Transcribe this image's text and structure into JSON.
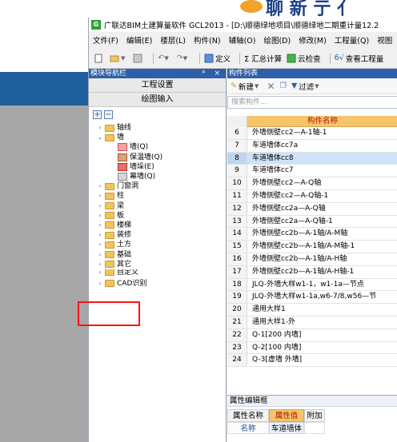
{
  "background": {
    "logo_text": "聊 新 亍 亻"
  },
  "window": {
    "title": "广联达BIM土建算量软件 GCL2013 - [D:\\顺德绿地项目\\顺德绿地二期重计量12.2"
  },
  "menu": [
    "文件(F)",
    "编辑(E)",
    "楼层(L)",
    "构件(N)",
    "辅轴(O)",
    "绘图(D)",
    "修改(M)",
    "工程量(Q)",
    "视图"
  ],
  "toolbar": {
    "define_label": "定义",
    "sum_label": "Σ 汇总计算",
    "cloud_check_label": "云检查",
    "view_quantity_label": "查看工程量"
  },
  "nav_panel": {
    "title": "模块导航栏",
    "header_controls": "ᵖ ×",
    "tabs": [
      "工程设置",
      "绘图输入"
    ],
    "expand_label": "+",
    "collapse_label": "−",
    "tree": [
      {
        "label": "轴线",
        "expanded": false,
        "level": 0
      },
      {
        "label": "墙",
        "expanded": true,
        "level": 0
      },
      {
        "label": "墙(Q)",
        "level": 1,
        "icon": "wall"
      },
      {
        "label": "保温墙(Q)",
        "level": 1,
        "icon": "insulation-wall"
      },
      {
        "label": "墙垛(E)",
        "level": 1,
        "icon": "wall-pier"
      },
      {
        "label": "幕墙(Q)",
        "level": 1,
        "icon": "curtain-wall"
      },
      {
        "label": "门窗洞",
        "expanded": false,
        "level": 0
      },
      {
        "label": "柱",
        "expanded": false,
        "level": 0
      },
      {
        "label": "梁",
        "expanded": false,
        "level": 0
      },
      {
        "label": "板",
        "expanded": false,
        "level": 0
      },
      {
        "label": "楼梯",
        "expanded": false,
        "level": 0
      },
      {
        "label": "装修",
        "expanded": false,
        "level": 0
      },
      {
        "label": "土方",
        "expanded": false,
        "level": 0
      },
      {
        "label": "基础",
        "expanded": false,
        "level": 0
      },
      {
        "label": "其它",
        "expanded": false,
        "level": 0
      },
      {
        "label": "自定义",
        "expanded": false,
        "level": 0
      },
      {
        "label": "CAD识别",
        "expanded": false,
        "level": 0
      }
    ]
  },
  "list_panel": {
    "title": "构件列表",
    "new_label": "新建",
    "filter_label": "过滤",
    "search_placeholder": "搜索构件...",
    "column_header": "构件名称",
    "rows": [
      {
        "num": "6",
        "name": "外墙侧壁cc2—A-1轴-1"
      },
      {
        "num": "7",
        "name": "车道墙体cc7a"
      },
      {
        "num": "8",
        "name": "车道墙体cc8",
        "selected": true
      },
      {
        "num": "9",
        "name": "车道墙体cc7"
      },
      {
        "num": "10",
        "name": "外墙侧壁cc2—A-Q轴"
      },
      {
        "num": "11",
        "name": "外墙侧壁cc2—A-Q轴-1"
      },
      {
        "num": "12",
        "name": "外墙侧壁cc2a—A-Q轴"
      },
      {
        "num": "13",
        "name": "外墙侧壁cc2a—A-Q轴-1"
      },
      {
        "num": "14",
        "name": "外墙侧壁cc2b—A-1轴/A-M轴"
      },
      {
        "num": "15",
        "name": "外墙侧壁cc2b—A-1轴/A-M轴-1"
      },
      {
        "num": "16",
        "name": "外墙侧壁cc2b—A-1轴/A-H轴"
      },
      {
        "num": "17",
        "name": "外墙侧壁cc2b—A-1轴/A-H轴-1"
      },
      {
        "num": "18",
        "name": "JLQ-外墙大样w1-1，w1-1a—节点"
      },
      {
        "num": "19",
        "name": "JLQ-外墙大样w1-1a,w6-7/8,w56—节"
      },
      {
        "num": "20",
        "name": "通用大样1"
      },
      {
        "num": "21",
        "name": "通用大样1-外"
      },
      {
        "num": "22",
        "name": "Q-1[200 内墙]"
      },
      {
        "num": "23",
        "name": "Q-2[100 内墙]"
      },
      {
        "num": "24",
        "name": "Q-3[虚墙 外墙]"
      }
    ]
  },
  "props_panel": {
    "title": "属性编辑框",
    "col_name": "属性名称",
    "col_value": "属性值",
    "col_extra": "附加",
    "row_name": "名称",
    "row_value": "车道墙体"
  },
  "colors": {
    "nav_header": "#2f5fa8",
    "column_header_bg": "#f6c46a",
    "highlight_box": "#ff1212",
    "selected_row": "#cfe3f8"
  }
}
